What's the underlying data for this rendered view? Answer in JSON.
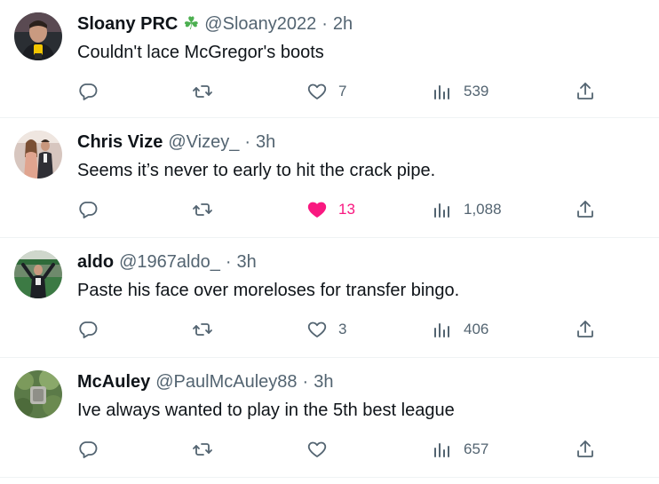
{
  "colors": {
    "like_active": "#f91880",
    "muted": "#536471",
    "text": "#0f1419",
    "divider": "#eff3f4"
  },
  "tweets": [
    {
      "name": "Sloany PRC",
      "name_emoji": "clover-icon",
      "handle": "@Sloany2022",
      "time": "2h",
      "text": "Couldn't lace McGregor's boots",
      "likes": "7",
      "liked": false,
      "views": "539"
    },
    {
      "name": "Chris Vize",
      "handle": "@Vizey_",
      "time": "3h",
      "text": "Seems it’s never to early to hit the crack pipe.",
      "likes": "13",
      "liked": true,
      "views": "1,088"
    },
    {
      "name": "aldo",
      "handle": "@1967aldo_",
      "time": "3h",
      "text": "Paste his face over moreloses for transfer bingo.",
      "likes": "3",
      "liked": false,
      "views": "406"
    },
    {
      "name": "McAuley",
      "handle": "@PaulMcAuley88",
      "time": "3h",
      "text": "Ive always wanted to play in the 5th best league",
      "likes": "",
      "liked": false,
      "views": "657"
    }
  ],
  "separator": "·"
}
